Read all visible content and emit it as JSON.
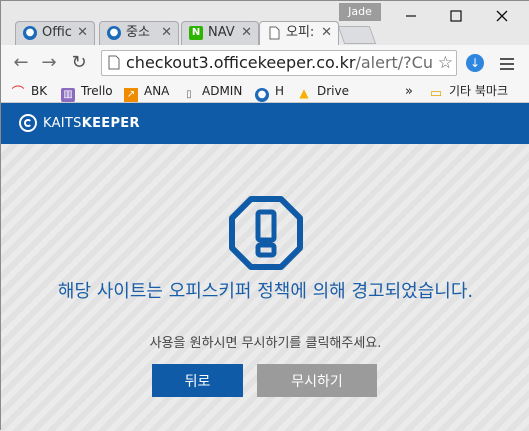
{
  "browser": {
    "profile_name": "Jade",
    "tabs": [
      {
        "title": "Offic",
        "icon": "kaits-icon",
        "active": false
      },
      {
        "title": "중소",
        "icon": "kaits-icon",
        "active": false
      },
      {
        "title": "NAV",
        "icon": "naver-icon",
        "active": false
      },
      {
        "title": "오피:",
        "icon": "page-icon",
        "active": true
      }
    ],
    "url_host": "checkout3.officekeeper.co.kr",
    "url_path": "/alert/?Culture",
    "bookmarks": [
      "BK",
      "Trello",
      "ANA",
      "ADMIN",
      "H",
      "Drive"
    ],
    "bookmarks_overflow": "»",
    "other_bookmarks": "기타 북마크"
  },
  "page": {
    "brand_light": "KAITS",
    "brand_bold": "KEEPER",
    "warning_message": "해당 사이트는 오피스키퍼 정책에 의해 경고되었습니다.",
    "sub_message": "사용을 원하시면 무시하기를 클릭해주세요.",
    "back_label": "뒤로",
    "ignore_label": "무시하기"
  },
  "colors": {
    "brand_blue": "#0f5ba8",
    "ignore_gray": "#9b9b9b",
    "message_blue": "#1b5ea8"
  }
}
